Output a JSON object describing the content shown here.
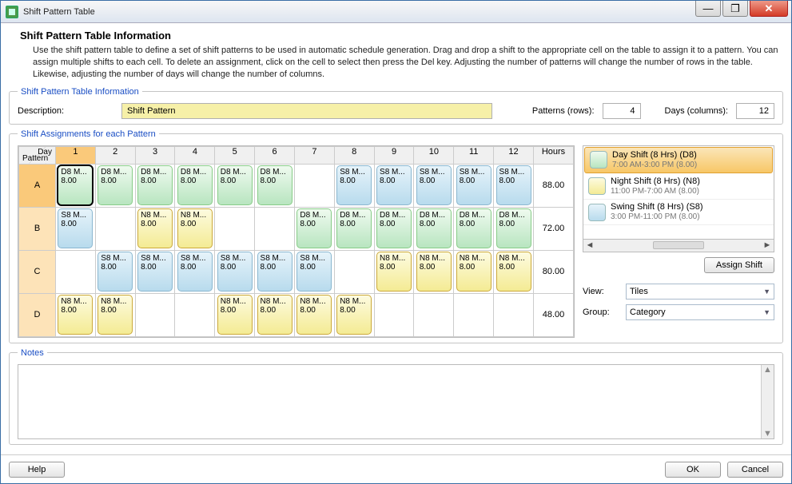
{
  "window": {
    "title": "Shift Pattern Table"
  },
  "winbtns": {
    "min": "—",
    "max": "❐",
    "close": "✕"
  },
  "header": {
    "title": "Shift Pattern Table Information",
    "text": "Use the shift pattern table to define a set of shift patterns to be used in automatic schedule generation. Drag and drop a shift to the appropriate cell on the table to assign it to a pattern. You can assign multiple shifts to each cell. To delete an assignment, click on the cell to select then press the Del key.  Adjusting the number of patterns will change the number of rows in the table. Likewise, adjusting the number of days will change the number of columns."
  },
  "info": {
    "legend": "Shift Pattern Table Information",
    "description_label": "Description:",
    "description_value": "Shift Pattern",
    "patterns_label": "Patterns (rows):",
    "patterns_value": "4",
    "days_label": "Days (columns):",
    "days_value": "12"
  },
  "assign": {
    "legend": "Shift Assignments for each Pattern",
    "corner_top": "Day",
    "corner_bottom": "Pattern",
    "days": [
      "1",
      "2",
      "3",
      "4",
      "5",
      "6",
      "7",
      "8",
      "9",
      "10",
      "11",
      "12"
    ],
    "hours_label": "Hours",
    "patterns": [
      "A",
      "B",
      "C",
      "D"
    ],
    "hours": [
      "88.00",
      "72.00",
      "80.00",
      "48.00"
    ],
    "shift_defs": {
      "D8": {
        "label": "D8 M...",
        "hours": "8.00"
      },
      "N8": {
        "label": "N8 M...",
        "hours": "8.00"
      },
      "S8": {
        "label": "S8 M...",
        "hours": "8.00"
      }
    },
    "grid": [
      [
        "D8",
        "D8",
        "D8",
        "D8",
        "D8",
        "D8",
        "",
        "S8",
        "S8",
        "S8",
        "S8",
        "S8"
      ],
      [
        "S8",
        "",
        "N8",
        "N8",
        "",
        "",
        "D8",
        "D8",
        "D8",
        "D8",
        "D8",
        "D8"
      ],
      [
        "",
        "S8",
        "S8",
        "S8",
        "S8",
        "S8",
        "S8",
        "",
        "N8",
        "N8",
        "N8",
        "N8"
      ],
      [
        "N8",
        "N8",
        "",
        "",
        "N8",
        "N8",
        "N8",
        "N8",
        "",
        "",
        "",
        ""
      ]
    ],
    "selected": {
      "row": 0,
      "col": 0
    }
  },
  "palette": {
    "items": [
      {
        "key": "D8",
        "title": "Day Shift (8 Hrs) (D8)",
        "sub": "7:00 AM-3:00 PM (8.00)",
        "selected": true
      },
      {
        "key": "N8",
        "title": "Night Shift (8 Hrs) (N8)",
        "sub": "11:00 PM-7:00 AM (8.00)",
        "selected": false
      },
      {
        "key": "S8",
        "title": "Swing Shift (8 Hrs) (S8)",
        "sub": "3:00 PM-11:00 PM (8.00)",
        "selected": false
      }
    ],
    "scroll_thumb": "⊪",
    "assign_button": "Assign Shift",
    "view_label": "View:",
    "view_value": "Tiles",
    "group_label": "Group:",
    "group_value": "Category"
  },
  "notes": {
    "legend": "Notes",
    "value": ""
  },
  "buttons": {
    "help": "Help",
    "ok": "OK",
    "cancel": "Cancel"
  }
}
